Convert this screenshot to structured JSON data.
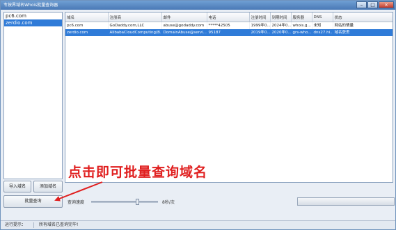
{
  "window": {
    "title": "专按界域名Whois批量查询器",
    "minimize": "–",
    "maximize": "□",
    "close": "×"
  },
  "domain_list": [
    "pc6.com",
    "zerdio.com"
  ],
  "grid": {
    "headers": [
      "域名",
      "注册商",
      "邮件",
      "电话",
      "注册时间",
      "到期时间",
      "服务器",
      "DNS",
      "状态"
    ],
    "rows": [
      [
        "pc6.com",
        "GoDaddy.com,LLC",
        "abuse@godaddy.com",
        "*****42505",
        "1999年0...",
        "2024年0...",
        "whois.g...",
        "未知",
        "网站的情量"
      ],
      [
        "zerdio.com",
        "AlibabaCloudComputing(B...",
        "DomainAbuse@servi...",
        "95187",
        "2019年0...",
        "2020年0...",
        "grs-who...",
        "dns27.hi...",
        "域名获丢"
      ]
    ]
  },
  "buttons": {
    "import": "导入域名",
    "add": "添加域名",
    "query": "批量查询"
  },
  "speed": {
    "label": "查询速度",
    "value_text": "8秒/次",
    "level": 0.7
  },
  "annotation": {
    "text": "点击即可批量查询域名",
    "color": "#e01f1f"
  },
  "status": {
    "label": "运行提示：",
    "message": "所有域名已查询完毕!"
  },
  "colors": {
    "selection": "#2f7bd8",
    "accent_red": "#e01f1f"
  }
}
